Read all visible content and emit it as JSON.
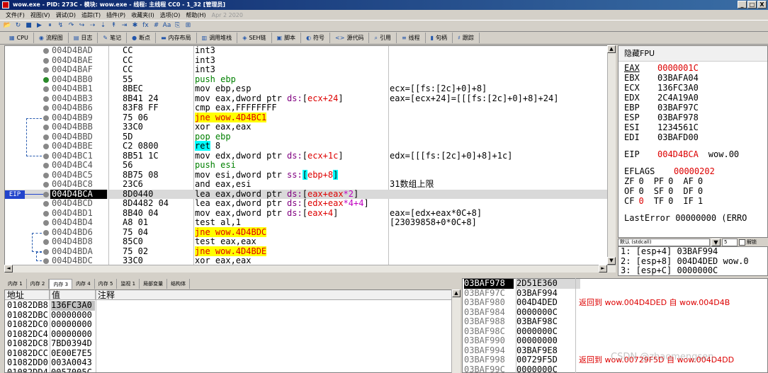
{
  "window": {
    "title": "wow.exe - PID: 273C - 模块: wow.exe - 线程: 主线程 CC0 - 1_32 [管理员]",
    "btn_min": "_",
    "btn_max": "□",
    "btn_close": "X"
  },
  "menu": [
    "文件(F)",
    "视图(V)",
    "调试(D)",
    "追踪(T)",
    "插件(P)",
    "收藏夹(I)",
    "选项(O)",
    "帮助(H)"
  ],
  "menu_date": "Apr 2 2020",
  "toolbar_icons": [
    "📂",
    "↻",
    "■",
    "▶",
    "⏸",
    "↯",
    "↷",
    "↪",
    "⇢",
    "⇣",
    "↟",
    "⇥",
    "✱",
    "fx",
    "#",
    "Aa",
    "⎘",
    "⊞"
  ],
  "tabs": [
    {
      "icon": "▦",
      "label": "CPU"
    },
    {
      "icon": "◉",
      "label": "流程图"
    },
    {
      "icon": "▤",
      "label": "日志"
    },
    {
      "icon": "✎",
      "label": "笔记"
    },
    {
      "icon": "●",
      "label": "断点"
    },
    {
      "icon": "▬",
      "label": "内存布局"
    },
    {
      "icon": "▥",
      "label": "调用堆栈"
    },
    {
      "icon": "◈",
      "label": "SEH链"
    },
    {
      "icon": "▣",
      "label": "脚本"
    },
    {
      "icon": "◐",
      "label": "符号"
    },
    {
      "icon": "<>",
      "label": "源代码"
    },
    {
      "icon": "⌕",
      "label": "引用"
    },
    {
      "icon": "≡",
      "label": "线程"
    },
    {
      "icon": "▮",
      "label": "句柄"
    },
    {
      "icon": "♯",
      "label": "跟踪"
    }
  ],
  "cpu": {
    "eip_label": "EIP",
    "rows": [
      {
        "addr": "004D4BAD",
        "hex": "CC",
        "dis": [
          {
            "t": "int3",
            "c": ""
          }
        ],
        "com": ""
      },
      {
        "addr": "004D4BAE",
        "hex": "CC",
        "dis": [
          {
            "t": "int3",
            "c": ""
          }
        ],
        "com": ""
      },
      {
        "addr": "004D4BAF",
        "hex": "CC",
        "dis": [
          {
            "t": "int3",
            "c": ""
          }
        ],
        "com": ""
      },
      {
        "addr": "004D4BB0",
        "hex": "55",
        "dis": [
          {
            "t": "push ebp",
            "c": "g"
          }
        ],
        "com": ""
      },
      {
        "addr": "004D4BB1",
        "hex": "8BEC",
        "dis": [
          {
            "t": "mov ebp,esp",
            "c": ""
          }
        ],
        "com": "ecx=[[fs:[2c]+0]+8]"
      },
      {
        "addr": "004D4BB3",
        "hex": "8B41 24",
        "dis": [
          {
            "t": "mov eax,dword ptr ",
            "c": ""
          },
          {
            "t": "ds:",
            "c": "p"
          },
          {
            "t": "[",
            "c": ""
          },
          {
            "t": "ecx+24",
            "c": "r"
          },
          {
            "t": "]",
            "c": ""
          }
        ],
        "com": "eax=[ecx+24]=[[[fs:[2c]+0]+8]+24]"
      },
      {
        "addr": "004D4BB6",
        "hex": "83F8 FF",
        "dis": [
          {
            "t": "cmp eax,FFFFFFFF",
            "c": ""
          }
        ],
        "com": ""
      },
      {
        "addr": "004D4BB9",
        "hex": "75 06",
        "dis": [
          {
            "t": "jne wow.4D4BC1",
            "c": "y"
          }
        ],
        "com": ""
      },
      {
        "addr": "004D4BBB",
        "hex": "33C0",
        "dis": [
          {
            "t": "xor eax,eax",
            "c": ""
          }
        ],
        "com": ""
      },
      {
        "addr": "004D4BBD",
        "hex": "5D",
        "dis": [
          {
            "t": "pop ebp",
            "c": "g"
          }
        ],
        "com": ""
      },
      {
        "addr": "004D4BBE",
        "hex": "C2 0800",
        "dis": [
          {
            "t": "ret",
            "c": "c"
          },
          {
            "t": " 8",
            "c": ""
          }
        ],
        "com": ""
      },
      {
        "addr": "004D4BC1",
        "hex": "8B51 1C",
        "dis": [
          {
            "t": "mov edx,dword ptr ",
            "c": ""
          },
          {
            "t": "ds:",
            "c": "p"
          },
          {
            "t": "[",
            "c": ""
          },
          {
            "t": "ecx+1c",
            "c": "r"
          },
          {
            "t": "]",
            "c": ""
          }
        ],
        "com": "edx=[[[fs:[2c]+0]+8]+1c]"
      },
      {
        "addr": "004D4BC4",
        "hex": "56",
        "dis": [
          {
            "t": "push esi",
            "c": "g"
          }
        ],
        "com": ""
      },
      {
        "addr": "004D4BC5",
        "hex": "8B75 08",
        "dis": [
          {
            "t": "mov esi,dword ptr ",
            "c": ""
          },
          {
            "t": "ss:",
            "c": "p"
          },
          {
            "t": "[",
            "c": "c"
          },
          {
            "t": "ebp+8",
            "c": "r"
          },
          {
            "t": "]",
            "c": "c"
          }
        ],
        "com": ""
      },
      {
        "addr": "004D4BC8",
        "hex": "23C6",
        "dis": [
          {
            "t": "and eax,esi",
            "c": ""
          }
        ],
        "com": "31数组上限"
      },
      {
        "addr": "004D4BCA",
        "hex": "8D0440",
        "dis": [
          {
            "t": "lea eax,dword ptr ",
            "c": ""
          },
          {
            "t": "ds:",
            "c": "p"
          },
          {
            "t": "[",
            "c": ""
          },
          {
            "t": "eax+eax",
            "c": "r"
          },
          {
            "t": "*2",
            "c": "m"
          },
          {
            "t": "]",
            "c": ""
          }
        ],
        "com": "",
        "eip": true
      },
      {
        "addr": "004D4BCD",
        "hex": "8D4482 04",
        "dis": [
          {
            "t": "lea eax,dword ptr ",
            "c": ""
          },
          {
            "t": "ds:",
            "c": "p"
          },
          {
            "t": "[",
            "c": ""
          },
          {
            "t": "edx+eax",
            "c": "r"
          },
          {
            "t": "*4+4",
            "c": "m"
          },
          {
            "t": "]",
            "c": ""
          }
        ],
        "com": ""
      },
      {
        "addr": "004D4BD1",
        "hex": "8B40 04",
        "dis": [
          {
            "t": "mov eax,dword ptr ",
            "c": ""
          },
          {
            "t": "ds:",
            "c": "p"
          },
          {
            "t": "[",
            "c": ""
          },
          {
            "t": "eax+4",
            "c": "r"
          },
          {
            "t": "]",
            "c": ""
          }
        ],
        "com": "eax=[edx+eax*0C+8]"
      },
      {
        "addr": "004D4BD4",
        "hex": "A8 01",
        "dis": [
          {
            "t": "test al,1",
            "c": ""
          }
        ],
        "com": "[23039858+0*0C+8]"
      },
      {
        "addr": "004D4BD6",
        "hex": "75 04",
        "dis": [
          {
            "t": "jne wow.4D4BDC",
            "c": "y"
          }
        ],
        "com": ""
      },
      {
        "addr": "004D4BD8",
        "hex": "85C0",
        "dis": [
          {
            "t": "test eax,eax",
            "c": ""
          }
        ],
        "com": ""
      },
      {
        "addr": "004D4BDA",
        "hex": "75 02",
        "dis": [
          {
            "t": "jne wow.4D4BDE",
            "c": "y"
          }
        ],
        "com": ""
      },
      {
        "addr": "004D4BDC",
        "hex": "33C0",
        "dis": [
          {
            "t": "xor eax,eax",
            "c": ""
          }
        ],
        "com": ""
      }
    ]
  },
  "regs": {
    "title": "隐藏FPU",
    "gp": [
      {
        "n": "EAX",
        "v": "0000001C",
        "red": true
      },
      {
        "n": "EBX",
        "v": "03BAFA04"
      },
      {
        "n": "ECX",
        "v": "136FC3A0"
      },
      {
        "n": "EDX",
        "v": "2C4A19A0"
      },
      {
        "n": "EBP",
        "v": "03BAF97C"
      },
      {
        "n": "ESP",
        "v": "03BAF978"
      },
      {
        "n": "ESI",
        "v": "1234561C"
      },
      {
        "n": "EDI",
        "v": "03BAFD00"
      }
    ],
    "eip_name": "EIP",
    "eip_val": "004D4BCA",
    "eip_sym": "wow.00",
    "eflags_name": "EFLAGS",
    "eflags_val": "00000202",
    "flags_rows": [
      [
        {
          "n": "ZF",
          "v": "0"
        },
        {
          "n": "PF",
          "v": "0"
        },
        {
          "n": "AF",
          "v": "0"
        }
      ],
      [
        {
          "n": "OF",
          "v": "0"
        },
        {
          "n": "SF",
          "v": "0"
        },
        {
          "n": "DF",
          "v": "0"
        }
      ],
      [
        {
          "n": "CF",
          "v": "0",
          "red": true
        },
        {
          "n": "TF",
          "v": "0"
        },
        {
          "n": "IF",
          "v": "1"
        }
      ]
    ],
    "lasterror": "LastError  00000000 (ERRO"
  },
  "stackcfg": {
    "conv": "默认 (stdcall)",
    "num": "5",
    "unlock": "解锁"
  },
  "callstack": [
    "1: [esp+4] 03BAF994",
    "2: [esp+8] 004D4DED wow.0",
    "3: [esp+C] 0000000C"
  ],
  "memtabs": [
    "内存 1",
    "内存 2",
    "内存 3",
    "内存 4",
    "内存 5",
    "监视 1",
    "局部变量",
    "结构体"
  ],
  "dump": {
    "headers": [
      "地址",
      "值",
      "注释"
    ],
    "rows": [
      {
        "a": "01082DB8",
        "v": "136FC3A0",
        "sel": true
      },
      {
        "a": "01082DBC",
        "v": "00000000"
      },
      {
        "a": "01082DC0",
        "v": "00000000"
      },
      {
        "a": "01082DC4",
        "v": "00000000"
      },
      {
        "a": "01082DC8",
        "v": "7BD0394D"
      },
      {
        "a": "01082DCC",
        "v": "0E00E7E5"
      },
      {
        "a": "01082DD0",
        "v": "003A0043"
      },
      {
        "a": "01082DD4",
        "v": "0057005C"
      }
    ]
  },
  "stack": [
    {
      "a": "03BAF978",
      "v": "2D51E360",
      "c": "",
      "top": true
    },
    {
      "a": "03BAF97C",
      "v": "03BAF994",
      "c": ""
    },
    {
      "a": "03BAF980",
      "v": "004D4DED",
      "c": "返回到 wow.004D4DED 自 wow.004D4B"
    },
    {
      "a": "03BAF984",
      "v": "0000000C",
      "c": ""
    },
    {
      "a": "03BAF988",
      "v": "03BAF98C",
      "c": ""
    },
    {
      "a": "03BAF98C",
      "v": "0000000C",
      "c": ""
    },
    {
      "a": "03BAF990",
      "v": "00000000",
      "c": ""
    },
    {
      "a": "03BAF994",
      "v": "03BAF9E8",
      "c": ""
    },
    {
      "a": "03BAF998",
      "v": "00729F5D",
      "c": "返回到 wow.00729F5D 自 wow.004D4DD"
    },
    {
      "a": "03BAF99C",
      "v": "0000000C",
      "c": ""
    }
  ],
  "watermark": "CSDN @zhaomengsen"
}
